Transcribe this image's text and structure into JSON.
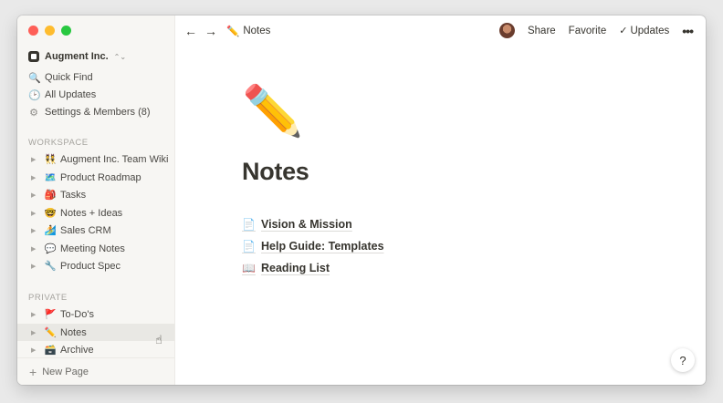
{
  "colors": {
    "red": "#fe5f57",
    "yellow": "#febc2e",
    "green": "#28c840",
    "sidebar_bg": "#f7f6f3"
  },
  "workspace": {
    "name": "Augment Inc.",
    "chevron": "⌃⌄"
  },
  "menu": [
    {
      "icon": "🔍",
      "icon_name": "search-icon",
      "label": "Quick Find"
    },
    {
      "icon": "🕑",
      "icon_name": "clock-icon",
      "label": "All Updates"
    },
    {
      "icon": "⚙",
      "icon_name": "gear-icon",
      "label": "Settings & Members (8)"
    }
  ],
  "workspace_section": {
    "label": "WORKSPACE",
    "pages": [
      {
        "emoji": "👯",
        "label": "Augment Inc. Team Wiki"
      },
      {
        "emoji": "🗺️",
        "label": "Product Roadmap"
      },
      {
        "emoji": "🎒",
        "label": "Tasks"
      },
      {
        "emoji": "🤓",
        "label": "Notes + Ideas"
      },
      {
        "emoji": "🏄",
        "label": "Sales CRM"
      },
      {
        "emoji": "💬",
        "label": "Meeting Notes"
      },
      {
        "emoji": "🔧",
        "label": "Product Spec"
      }
    ]
  },
  "private_section": {
    "label": "PRIVATE",
    "pages": [
      {
        "emoji": "🚩",
        "label": "To-Do's"
      },
      {
        "emoji": "✏️",
        "label": "Notes"
      },
      {
        "emoji": "🗃️",
        "label": "Archive"
      }
    ]
  },
  "new_page": "New Page",
  "topbar": {
    "back": "←",
    "forward": "→",
    "crumb_emoji": "✏️",
    "crumb_label": "Notes",
    "share": "Share",
    "favorite": "Favorite",
    "updates_check": "✓",
    "updates": "Updates",
    "more": "•••"
  },
  "page": {
    "emoji": "✏️",
    "title": "Notes",
    "subpages": [
      {
        "icon": "📄",
        "icon_name": "document-icon",
        "label": "Vision & Mission"
      },
      {
        "icon": "📄",
        "icon_name": "document-icon",
        "label": "Help Guide: Templates"
      },
      {
        "icon": "📖",
        "icon_name": "open-book-icon",
        "label": "Reading List"
      }
    ]
  },
  "help": "?"
}
